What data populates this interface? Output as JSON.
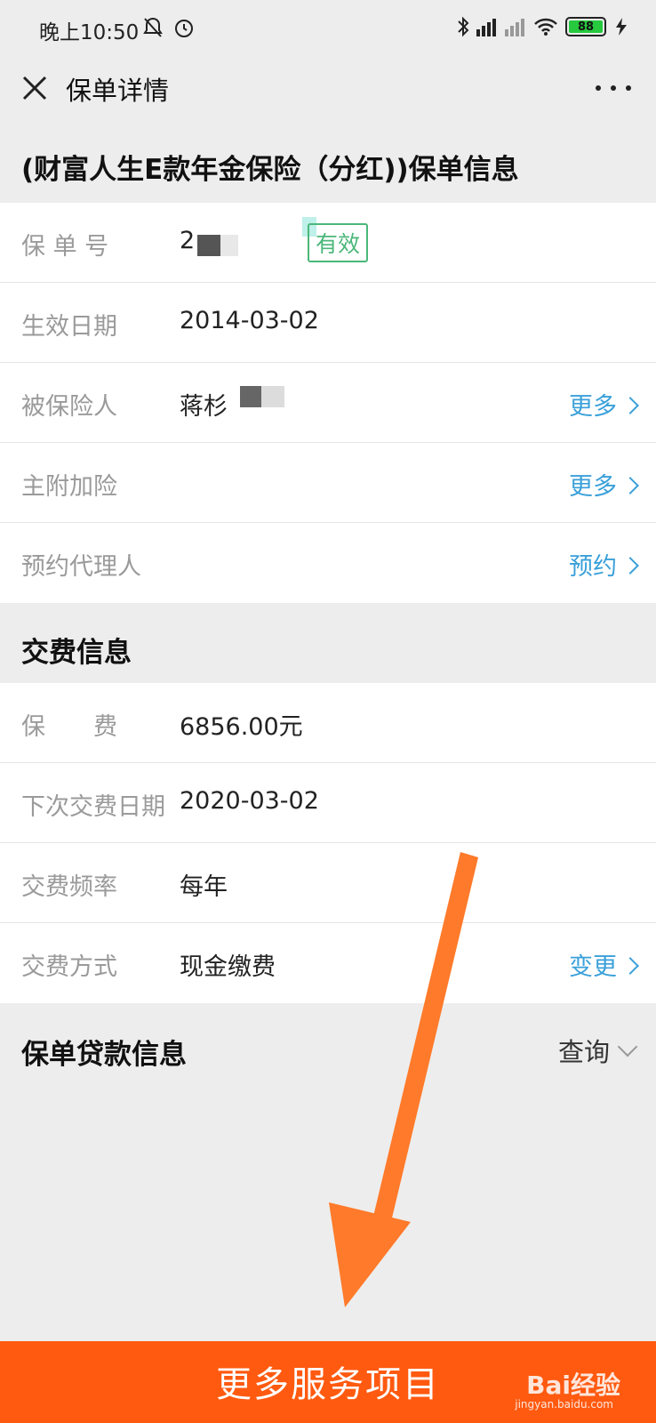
{
  "status_bar": {
    "time": "晚上10:50",
    "battery": "88",
    "icons": [
      "mute-icon",
      "alarm-icon",
      "bluetooth-icon",
      "signal-icon",
      "wifi-icon",
      "charging-icon"
    ]
  },
  "header": {
    "title": "保单详情",
    "close_icon": "close-icon",
    "more_icon": "more-icon"
  },
  "policy_section": {
    "title": "(财富人生E款年金保险（分红))保单信息",
    "rows": [
      {
        "label": "保 单 号",
        "value": "2",
        "badge": "有效"
      },
      {
        "label": "生效日期",
        "value": "2014-03-02"
      },
      {
        "label": "被保险人",
        "value": "蒋杉",
        "action": "更多"
      },
      {
        "label": "主附加险",
        "value": "",
        "action": "更多"
      },
      {
        "label": "预约代理人",
        "value": "",
        "action": "预约"
      }
    ]
  },
  "payment_section": {
    "title": "交费信息",
    "rows": [
      {
        "label": "保　　费",
        "value": "6856.00元"
      },
      {
        "label": "下次交费日期",
        "value": "2020-03-02"
      },
      {
        "label": "交费频率",
        "value": "每年"
      },
      {
        "label": "交费方式",
        "value": "现金缴费",
        "action": "变更"
      }
    ]
  },
  "loan_section": {
    "title": "保单贷款信息",
    "action": "查询"
  },
  "bottom_button": {
    "label": "更多服务项目"
  },
  "watermark": {
    "brand": "Bai经验",
    "url": "jingyan.baidu.com"
  },
  "colors": {
    "link": "#3aa0d9",
    "badge": "#4bb77a",
    "bottom_bar": "#ff5a10",
    "arrow": "#ff7a2a"
  }
}
